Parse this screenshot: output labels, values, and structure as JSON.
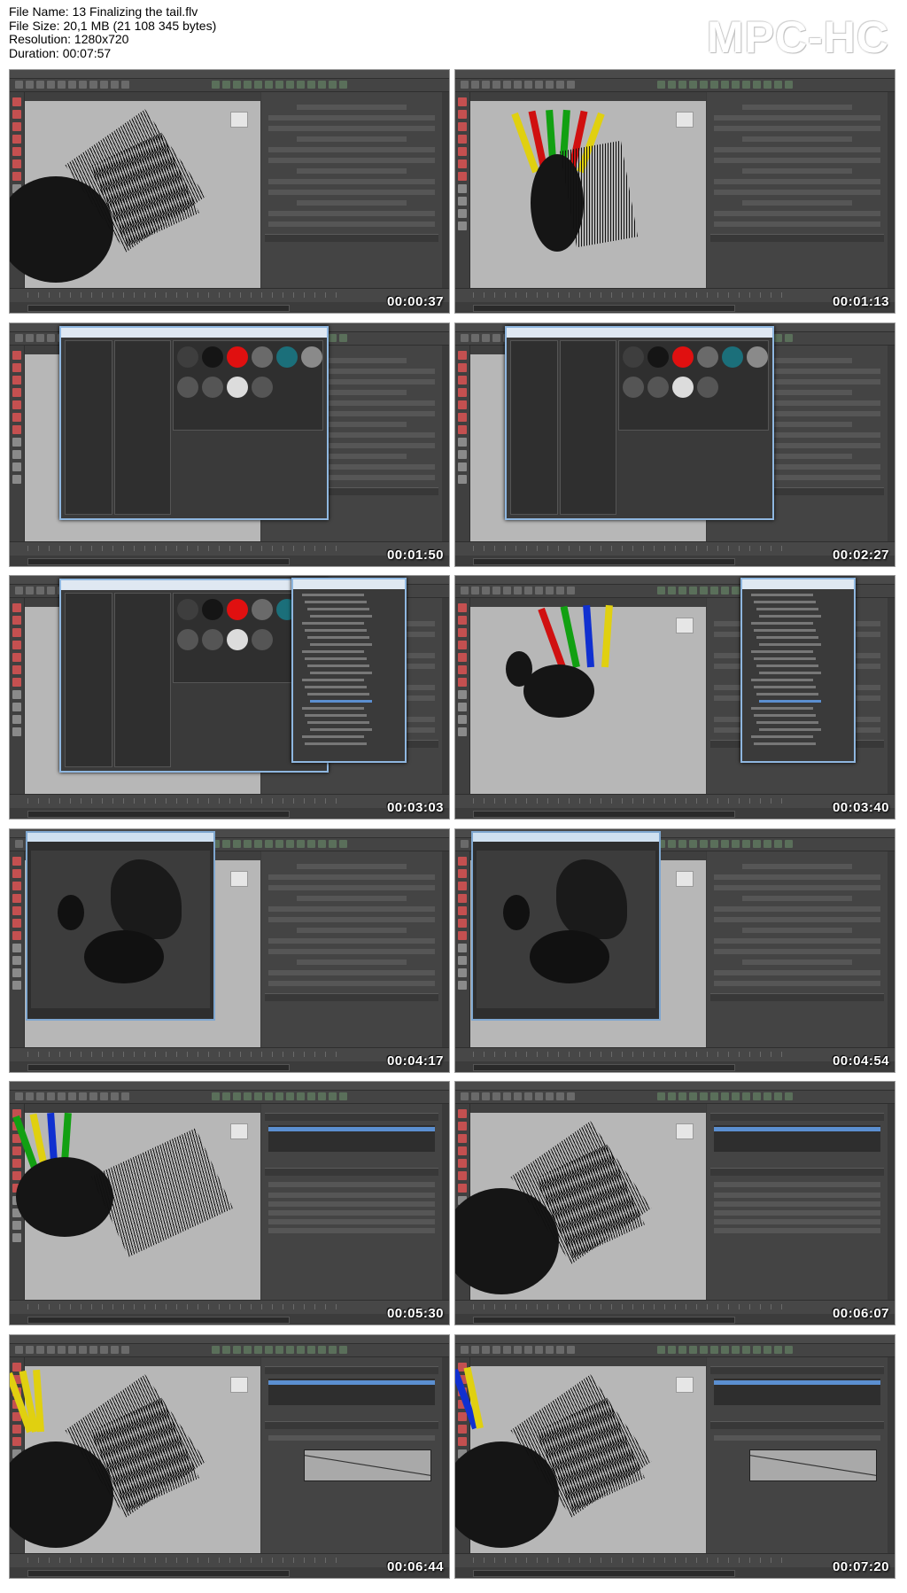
{
  "window": {
    "title": "MPC-HC"
  },
  "file_info": {
    "name_line": "File Name: 13 Finalizing the tail.flv",
    "size_line": "File Size: 20,1 MB (21 108 345 bytes)",
    "resolution_line": "Resolution: 1280x720",
    "duration_line": "Duration: 00:07:57"
  },
  "thumbnails": [
    {
      "timestamp": "00:00:37",
      "scene": "tail-closeup",
      "panel": "attribute-editor"
    },
    {
      "timestamp": "00:01:13",
      "scene": "horse-back-wings",
      "panel": "attribute-editor"
    },
    {
      "timestamp": "00:01:50",
      "scene": "hypershade",
      "panel": "hypershade"
    },
    {
      "timestamp": "00:02:27",
      "scene": "hypershade",
      "panel": "hypershade"
    },
    {
      "timestamp": "00:03:03",
      "scene": "hypershade-outliner",
      "panel": "outliner"
    },
    {
      "timestamp": "00:03:40",
      "scene": "horse-rearing-wings",
      "panel": "outliner"
    },
    {
      "timestamp": "00:04:17",
      "scene": "render-view",
      "panel": "attribute-editor"
    },
    {
      "timestamp": "00:04:54",
      "scene": "render-view",
      "panel": "attribute-editor"
    },
    {
      "timestamp": "00:05:30",
      "scene": "horse-wings-side",
      "panel": "modifiers"
    },
    {
      "timestamp": "00:06:07",
      "scene": "tail-closeup-thin",
      "panel": "modifiers"
    },
    {
      "timestamp": "00:06:44",
      "scene": "tail-closeup-yellow",
      "panel": "modifiers-graph"
    },
    {
      "timestamp": "00:07:20",
      "scene": "tail-closeup-blue",
      "panel": "modifiers-graph"
    }
  ],
  "colors": {
    "viewport": "#b7b7b7",
    "panel": "#444444",
    "accent_blue": "#5b8fd0",
    "feather_red": "#d01010",
    "feather_green": "#12a012",
    "feather_blue": "#1030d0",
    "feather_yellow": "#e0d010"
  }
}
